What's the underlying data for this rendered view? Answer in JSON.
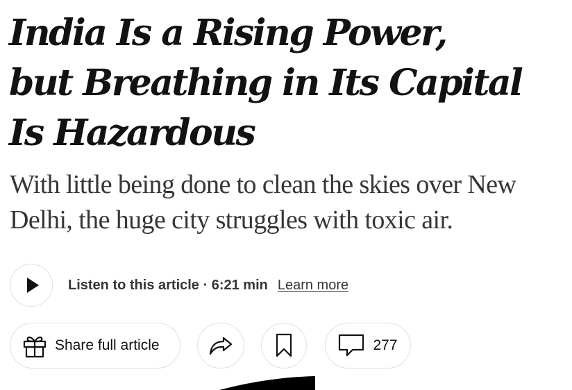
{
  "article": {
    "headline_lines": [
      "India Is a Rising Power,",
      "but Breathing in Its Capital",
      "Is Hazardous"
    ],
    "summary_lines": [
      "With little being done to clean the skies over New",
      "Delhi, the huge city struggles with toxic air."
    ]
  },
  "audio": {
    "play_icon": "play-icon",
    "listen_label": "Listen to this article · 6:21 min",
    "learn_more": "Learn more"
  },
  "actions": {
    "share_full_label": "Share full article",
    "gift_icon": "gift-icon",
    "share_icon": "share-arrow-icon",
    "save_icon": "bookmark-icon",
    "comment_icon": "comment-icon",
    "comment_count": "277"
  },
  "colors": {
    "text": "#121212",
    "summary_text": "#363636",
    "border": "#dfdfdf"
  }
}
